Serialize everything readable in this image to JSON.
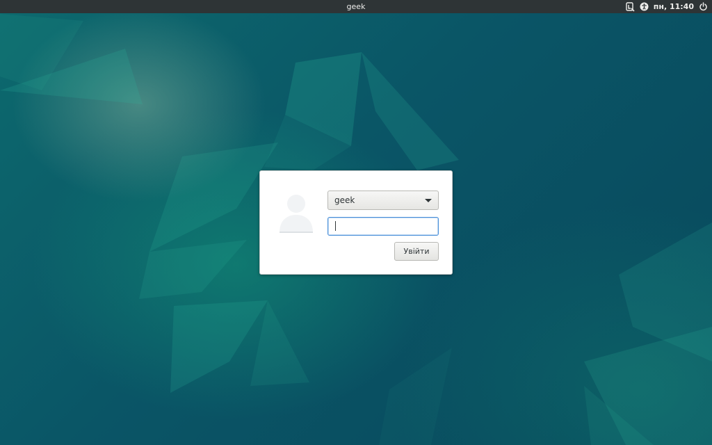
{
  "topbar": {
    "title": "geek",
    "clock": "пн, 11:40",
    "icons": {
      "indicator": "keyboard-layout-icon",
      "accessibility": "accessibility-icon",
      "power": "power-icon"
    }
  },
  "login": {
    "username": "geek",
    "password_value": "",
    "login_label": "Увійти",
    "avatar_icon": "user-avatar-icon"
  },
  "colors": {
    "topbar_bg": "#2e3436",
    "accent_focus": "#4a90d9",
    "wallpaper_base": "#0b4a5e"
  }
}
